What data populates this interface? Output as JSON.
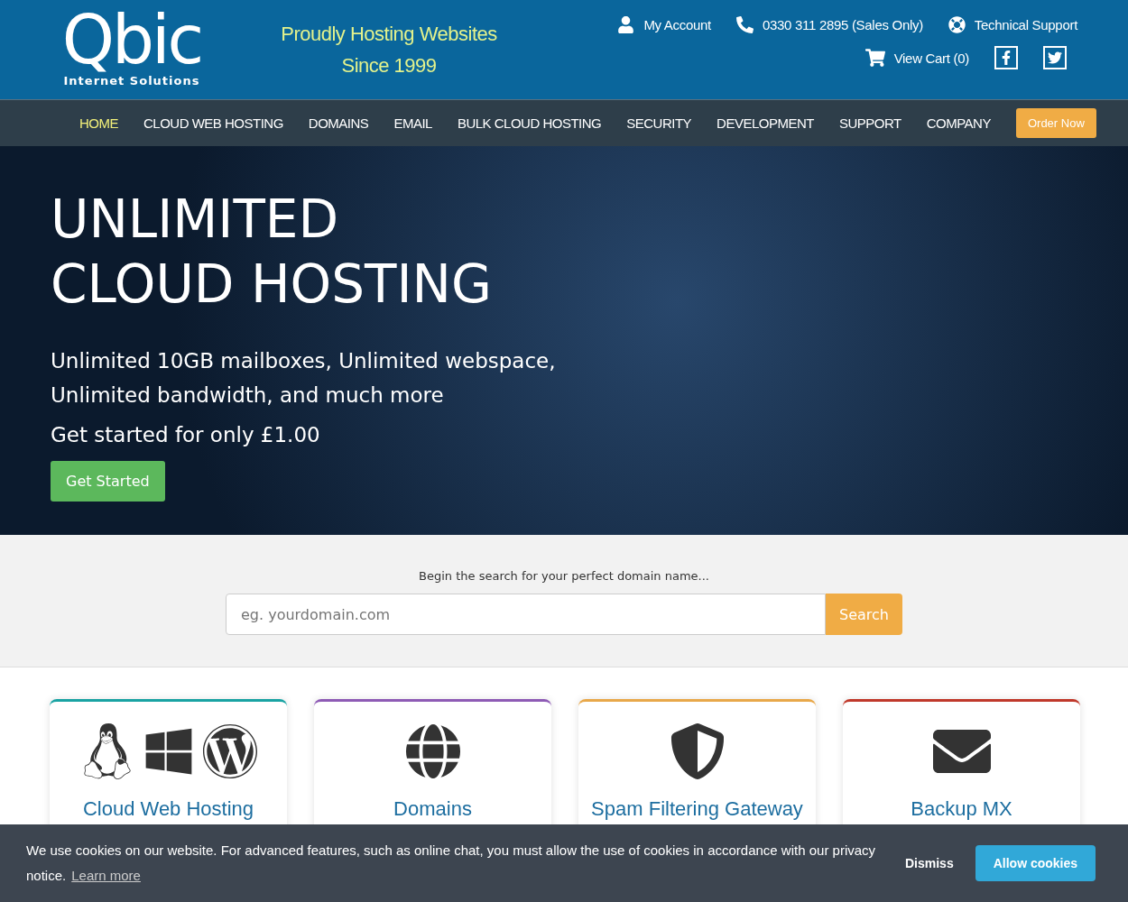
{
  "header": {
    "logo": {
      "name": "Qbic",
      "tagline": "Internet Solutions"
    },
    "slogan": [
      "Proudly Hosting Websites",
      "Since 1999"
    ],
    "links": [
      {
        "kind": "account",
        "label": "My Account"
      },
      {
        "kind": "phone",
        "label": "0330 311 2895 (Sales Only)"
      },
      {
        "kind": "support",
        "label": "Technical Support"
      }
    ],
    "cart": "View Cart (0)"
  },
  "nav": {
    "items": [
      {
        "label": "HOME",
        "selected": true
      },
      {
        "label": "CLOUD WEB HOSTING",
        "selected": false
      },
      {
        "label": "DOMAINS",
        "selected": false
      },
      {
        "label": "EMAIL",
        "selected": false
      },
      {
        "label": "BULK CLOUD HOSTING",
        "selected": false
      },
      {
        "label": "SECURITY",
        "selected": false
      },
      {
        "label": "DEVELOPMENT",
        "selected": false
      },
      {
        "label": "SUPPORT",
        "selected": false
      },
      {
        "label": "COMPANY",
        "selected": false
      }
    ],
    "order_button": "Order Now"
  },
  "hero": {
    "title": [
      "UNLIMITED",
      "CLOUD HOSTING"
    ],
    "subtitle": [
      "Unlimited 10GB mailboxes, Unlimited webspace,",
      "Unlimited bandwidth, and much more"
    ],
    "offer": "Get started for only £1.00",
    "button": "Get Started"
  },
  "domain_search": {
    "prompt": "Begin the search for your perfect domain name...",
    "placeholder": "eg. yourdomain.com",
    "button": "Search"
  },
  "cards": [
    {
      "kind": "servers",
      "title": "Cloud Web Hosting",
      "color": "#1aa3a3"
    },
    {
      "kind": "domains",
      "title": "Domains",
      "color": "#8e5bb5"
    },
    {
      "kind": "spam",
      "title": "Spam Filtering Gateway",
      "color": "#e8a84a"
    },
    {
      "kind": "mail",
      "title": "Backup MX",
      "color": "#c0392b"
    }
  ],
  "cookie_banner": {
    "text": "We use cookies on our website. For advanced features, such as online chat, you must allow the use of cookies in accordance with our privacy notice.",
    "link": "Learn more",
    "dismiss": "Dismiss",
    "allow": "Allow cookies"
  }
}
